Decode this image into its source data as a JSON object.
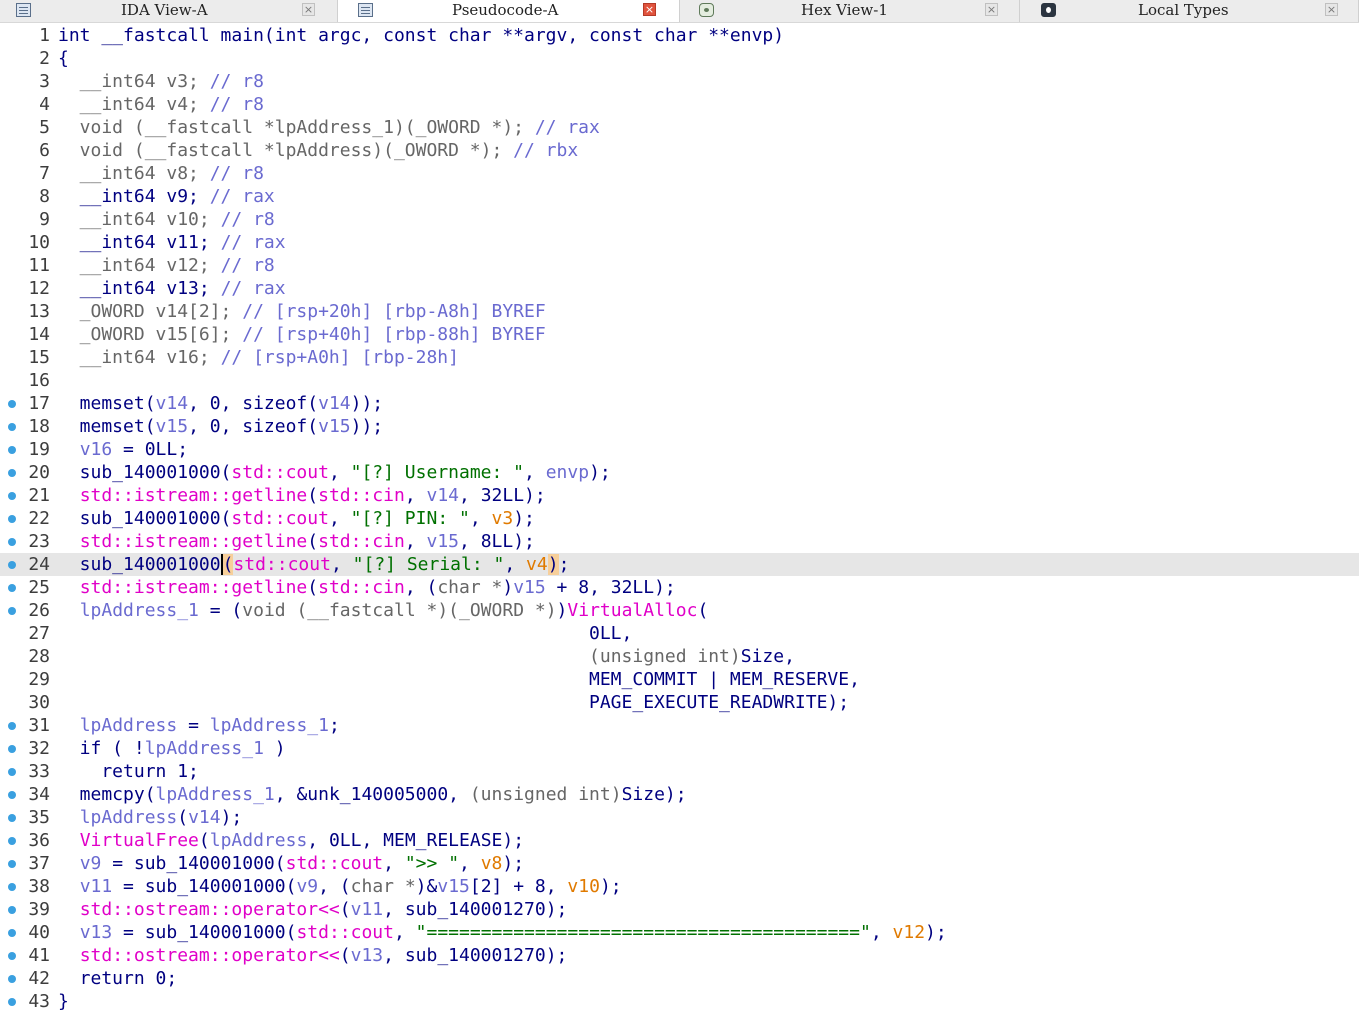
{
  "tabs": [
    {
      "label": "IDA View-A",
      "active": false,
      "icon": "disassembly-icon",
      "close": "×"
    },
    {
      "label": "Pseudocode-A",
      "active": true,
      "icon": "pseudocode-icon",
      "close": "×"
    },
    {
      "label": "Hex View-1",
      "active": false,
      "icon": "hex-view-icon",
      "close": "×"
    },
    {
      "label": "Local Types",
      "active": false,
      "icon": "local-types-icon",
      "close": "×"
    }
  ],
  "current_line": 24,
  "colors": {
    "keyword": "#000080",
    "local_var": "#6a6ad0",
    "register_comment": "#6a6ad0",
    "string": "#007000",
    "library_call": "#e000c8",
    "highlight_var": "#e07a00",
    "breakpoint_dot": "#3aa0e0",
    "current_line_bg": "#e6e6e6"
  },
  "lines": [
    {
      "num": "1",
      "bp": false,
      "tokens": [
        [
          "int __fastcall main(int argc, const char **argv, const char **envp)",
          "d"
        ]
      ]
    },
    {
      "num": "2",
      "bp": false,
      "tokens": [
        [
          "{",
          "d"
        ]
      ]
    },
    {
      "num": "3",
      "bp": false,
      "tokens": [
        [
          "  __int64 v3; ",
          "y"
        ],
        [
          "// r8",
          "v"
        ]
      ]
    },
    {
      "num": "4",
      "bp": false,
      "tokens": [
        [
          "  __int64 v4; ",
          "y"
        ],
        [
          "// r8",
          "v"
        ]
      ]
    },
    {
      "num": "5",
      "bp": false,
      "tokens": [
        [
          "  void (__fastcall *lpAddress_1)(_OWORD *); ",
          "y"
        ],
        [
          "// rax",
          "v"
        ]
      ]
    },
    {
      "num": "6",
      "bp": false,
      "tokens": [
        [
          "  void (__fastcall *lpAddress)(_OWORD *); ",
          "y"
        ],
        [
          "// rbx",
          "v"
        ]
      ]
    },
    {
      "num": "7",
      "bp": false,
      "tokens": [
        [
          "  __int64 v8; ",
          "y"
        ],
        [
          "// r8",
          "v"
        ]
      ]
    },
    {
      "num": "8",
      "bp": false,
      "tokens": [
        [
          "  __int64 v9; ",
          "d"
        ],
        [
          "// rax",
          "v"
        ]
      ]
    },
    {
      "num": "9",
      "bp": false,
      "tokens": [
        [
          "  __int64 v10; ",
          "y"
        ],
        [
          "// r8",
          "v"
        ]
      ]
    },
    {
      "num": "10",
      "bp": false,
      "tokens": [
        [
          "  __int64 v11; ",
          "d"
        ],
        [
          "// rax",
          "v"
        ]
      ]
    },
    {
      "num": "11",
      "bp": false,
      "tokens": [
        [
          "  __int64 v12; ",
          "y"
        ],
        [
          "// r8",
          "v"
        ]
      ]
    },
    {
      "num": "12",
      "bp": false,
      "tokens": [
        [
          "  __int64 v13; ",
          "d"
        ],
        [
          "// rax",
          "v"
        ]
      ]
    },
    {
      "num": "13",
      "bp": false,
      "tokens": [
        [
          "  _OWORD v14[2]; ",
          "y"
        ],
        [
          "// [rsp+20h] [rbp-A8h] BYREF",
          "v"
        ]
      ]
    },
    {
      "num": "14",
      "bp": false,
      "tokens": [
        [
          "  _OWORD v15[6]; ",
          "y"
        ],
        [
          "// [rsp+40h] [rbp-88h] BYREF",
          "v"
        ]
      ]
    },
    {
      "num": "15",
      "bp": false,
      "tokens": [
        [
          "  __int64 v16; ",
          "y"
        ],
        [
          "// [rsp+A0h] [rbp-28h]",
          "v"
        ]
      ]
    },
    {
      "num": "16",
      "bp": false,
      "tokens": []
    },
    {
      "num": "17",
      "bp": true,
      "tokens": [
        [
          "  memset(",
          "d"
        ],
        [
          "v14",
          "v"
        ],
        [
          ", 0, sizeof(",
          "d"
        ],
        [
          "v14",
          "v"
        ],
        [
          "));",
          "d"
        ]
      ]
    },
    {
      "num": "18",
      "bp": true,
      "tokens": [
        [
          "  memset(",
          "d"
        ],
        [
          "v15",
          "v"
        ],
        [
          ", 0, sizeof(",
          "d"
        ],
        [
          "v15",
          "v"
        ],
        [
          "));",
          "d"
        ]
      ]
    },
    {
      "num": "19",
      "bp": true,
      "tokens": [
        [
          "  ",
          "d"
        ],
        [
          "v16",
          "v"
        ],
        [
          " = 0LL;",
          "d"
        ]
      ]
    },
    {
      "num": "20",
      "bp": true,
      "tokens": [
        [
          "  sub_140001000(",
          "d"
        ],
        [
          "std::cout",
          "m"
        ],
        [
          ", ",
          "d"
        ],
        [
          "\"[?] Username: \"",
          "s"
        ],
        [
          ", ",
          "d"
        ],
        [
          "envp",
          "v"
        ],
        [
          ");",
          "d"
        ]
      ]
    },
    {
      "num": "21",
      "bp": true,
      "tokens": [
        [
          "  ",
          "d"
        ],
        [
          "std::istream::getline",
          "m"
        ],
        [
          "(",
          "d"
        ],
        [
          "std::cin",
          "m"
        ],
        [
          ", ",
          "d"
        ],
        [
          "v14",
          "v"
        ],
        [
          ", 32LL);",
          "d"
        ]
      ]
    },
    {
      "num": "22",
      "bp": true,
      "tokens": [
        [
          "  sub_140001000(",
          "d"
        ],
        [
          "std::cout",
          "m"
        ],
        [
          ", ",
          "d"
        ],
        [
          "\"[?] PIN: \"",
          "s"
        ],
        [
          ", ",
          "d"
        ],
        [
          "v3",
          "r"
        ],
        [
          ");",
          "d"
        ]
      ]
    },
    {
      "num": "23",
      "bp": true,
      "tokens": [
        [
          "  ",
          "d"
        ],
        [
          "std::istream::getline",
          "m"
        ],
        [
          "(",
          "d"
        ],
        [
          "std::cin",
          "m"
        ],
        [
          ", ",
          "d"
        ],
        [
          "v15",
          "v"
        ],
        [
          ", 8LL);",
          "d"
        ]
      ]
    },
    {
      "num": "24",
      "bp": true,
      "tokens": [
        [
          "  sub_14000100",
          "d"
        ],
        [
          "0",
          "cur"
        ],
        [
          "(",
          "hl"
        ],
        [
          "std::cout",
          "m"
        ],
        [
          ", ",
          "d"
        ],
        [
          "\"[?] Serial: \"",
          "s"
        ],
        [
          ", ",
          "d"
        ],
        [
          "v4",
          "r"
        ],
        [
          ")",
          "hl"
        ],
        [
          ";",
          "d"
        ]
      ]
    },
    {
      "num": "25",
      "bp": true,
      "tokens": [
        [
          "  ",
          "d"
        ],
        [
          "std::istream::getline",
          "m"
        ],
        [
          "(",
          "d"
        ],
        [
          "std::cin",
          "m"
        ],
        [
          ", (",
          "d"
        ],
        [
          "char *",
          "y"
        ],
        [
          ")",
          "d"
        ],
        [
          "v15",
          "v"
        ],
        [
          " + 8, 32LL);",
          "d"
        ]
      ]
    },
    {
      "num": "26",
      "bp": true,
      "tokens": [
        [
          "  ",
          "d"
        ],
        [
          "lpAddress_1",
          "v"
        ],
        [
          " = (",
          "d"
        ],
        [
          "void (__fastcall *)(_OWORD *)",
          "y"
        ],
        [
          ")",
          "d"
        ],
        [
          "VirtualAlloc",
          "m"
        ],
        [
          "(",
          "d"
        ]
      ]
    },
    {
      "num": "27",
      "bp": false,
      "tokens": [
        [
          "                                                 0LL,",
          "d"
        ]
      ]
    },
    {
      "num": "28",
      "bp": false,
      "tokens": [
        [
          "                                                 ",
          "d"
        ],
        [
          "(unsigned int)",
          "y"
        ],
        [
          "Size,",
          "d"
        ]
      ]
    },
    {
      "num": "29",
      "bp": false,
      "tokens": [
        [
          "                                                 MEM_COMMIT | MEM_RESERVE,",
          "d"
        ]
      ]
    },
    {
      "num": "30",
      "bp": false,
      "tokens": [
        [
          "                                                 PAGE_EXECUTE_READWRITE);",
          "d"
        ]
      ]
    },
    {
      "num": "31",
      "bp": true,
      "tokens": [
        [
          "  ",
          "d"
        ],
        [
          "lpAddress",
          "v"
        ],
        [
          " = ",
          "d"
        ],
        [
          "lpAddress_1",
          "v"
        ],
        [
          ";",
          "d"
        ]
      ]
    },
    {
      "num": "32",
      "bp": true,
      "tokens": [
        [
          "  if ( !",
          "d"
        ],
        [
          "lpAddress_1",
          "v"
        ],
        [
          " )",
          "d"
        ]
      ]
    },
    {
      "num": "33",
      "bp": true,
      "tokens": [
        [
          "    return 1;",
          "d"
        ]
      ]
    },
    {
      "num": "34",
      "bp": true,
      "tokens": [
        [
          "  memcpy(",
          "d"
        ],
        [
          "lpAddress_1",
          "v"
        ],
        [
          ", &unk_140005000, ",
          "d"
        ],
        [
          "(unsigned int)",
          "y"
        ],
        [
          "Size);",
          "d"
        ]
      ]
    },
    {
      "num": "35",
      "bp": true,
      "tokens": [
        [
          "  ",
          "d"
        ],
        [
          "lpAddress",
          "v"
        ],
        [
          "(",
          "d"
        ],
        [
          "v14",
          "v"
        ],
        [
          ");",
          "d"
        ]
      ]
    },
    {
      "num": "36",
      "bp": true,
      "tokens": [
        [
          "  ",
          "d"
        ],
        [
          "VirtualFree",
          "m"
        ],
        [
          "(",
          "d"
        ],
        [
          "lpAddress",
          "v"
        ],
        [
          ", 0LL, MEM_RELEASE);",
          "d"
        ]
      ]
    },
    {
      "num": "37",
      "bp": true,
      "tokens": [
        [
          "  ",
          "d"
        ],
        [
          "v9",
          "v"
        ],
        [
          " = sub_140001000(",
          "d"
        ],
        [
          "std::cout",
          "m"
        ],
        [
          ", ",
          "d"
        ],
        [
          "\">> \"",
          "s"
        ],
        [
          ", ",
          "d"
        ],
        [
          "v8",
          "r"
        ],
        [
          ");",
          "d"
        ]
      ]
    },
    {
      "num": "38",
      "bp": true,
      "tokens": [
        [
          "  ",
          "d"
        ],
        [
          "v11",
          "v"
        ],
        [
          " = sub_140001000(",
          "d"
        ],
        [
          "v9",
          "v"
        ],
        [
          ", (",
          "d"
        ],
        [
          "char *",
          "y"
        ],
        [
          ")&",
          "d"
        ],
        [
          "v15",
          "v"
        ],
        [
          "[2] + 8, ",
          "d"
        ],
        [
          "v10",
          "r"
        ],
        [
          ");",
          "d"
        ]
      ]
    },
    {
      "num": "39",
      "bp": true,
      "tokens": [
        [
          "  ",
          "d"
        ],
        [
          "std::ostream::operator<<",
          "m"
        ],
        [
          "(",
          "d"
        ],
        [
          "v11",
          "v"
        ],
        [
          ", sub_140001270);",
          "d"
        ]
      ]
    },
    {
      "num": "40",
      "bp": true,
      "tokens": [
        [
          "  ",
          "d"
        ],
        [
          "v13",
          "v"
        ],
        [
          " = sub_140001000(",
          "d"
        ],
        [
          "std::cout",
          "m"
        ],
        [
          ", ",
          "d"
        ],
        [
          "\"========================================\"",
          "s"
        ],
        [
          ", ",
          "d"
        ],
        [
          "v12",
          "r"
        ],
        [
          ");",
          "d"
        ]
      ]
    },
    {
      "num": "41",
      "bp": true,
      "tokens": [
        [
          "  ",
          "d"
        ],
        [
          "std::ostream::operator<<",
          "m"
        ],
        [
          "(",
          "d"
        ],
        [
          "v13",
          "v"
        ],
        [
          ", sub_140001270);",
          "d"
        ]
      ]
    },
    {
      "num": "42",
      "bp": true,
      "tokens": [
        [
          "  return 0;",
          "d"
        ]
      ]
    },
    {
      "num": "43",
      "bp": true,
      "tokens": [
        [
          "}",
          "d"
        ]
      ]
    }
  ]
}
